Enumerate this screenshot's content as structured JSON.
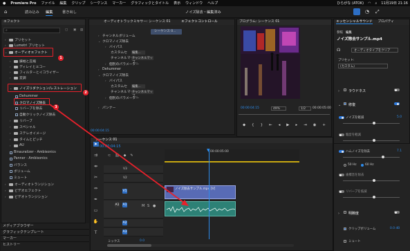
{
  "menubar": {
    "app": "Premiere Pro",
    "items": [
      "ファイル",
      "編集",
      "クリップ",
      "シーケンス",
      "マーカー",
      "グラフィックとタイトル",
      "表示",
      "ウィンドウ",
      "ヘルプ"
    ],
    "ime": "ひらがな (ATOK)",
    "clock": "11月19日 21:16"
  },
  "header": {
    "tabs": [
      "読み込み",
      "編集",
      "書き出し"
    ],
    "title": "ノイズ除去・編集済み"
  },
  "effects": {
    "title": "エフェクト",
    "items": [
      "プリセット",
      "Lumetri プリセット",
      "オーディオエフェクト",
      "振幅と圧縮",
      "ディレイとエコー",
      "フィルターとイコライザー",
      "変調",
      "ノイズリダクション/レストレーション",
      "Dehummer",
      "クロマノイズ除去",
      "リバーブを除去",
      "自動クリックノイズ除去",
      "リバーブ",
      "スペシャル",
      "ステレオイメージ",
      "タイムとピッチ",
      "AU",
      "Binauralizer - Ambisonics",
      "Panner - Ambisonics",
      "バランス",
      "ボリューム",
      "ミュート",
      "オーディオトランジション",
      "ビデオエフェクト",
      "ビデオトランジション"
    ],
    "bottom": [
      "メディアブラウザー",
      "グラフィックテンプレート",
      "マーカー",
      "ヒストリー"
    ],
    "badges": [
      "1",
      "2",
      "3"
    ]
  },
  "audiomixer": {
    "tab1": "オーディオトラックミキサー: シーケンス 01",
    "tab2": "エフェクトコントロール",
    "clip": "シーケンス 0...",
    "rows": [
      "チャンネルボリューム",
      "クロマノイズ除去",
      "バイパス",
      "カスタムセ",
      "編集...",
      "チャンネルマッパ",
      "チャンネルマップ...",
      "個別のパラメーター",
      "Dehummer",
      "クロマノイズ除去",
      "バイパス",
      "カスタムセ",
      "編集...",
      "チャンネルマッパ",
      "チャンネルマップ...",
      "個別のパラメーター",
      "パンナー"
    ],
    "time": "00:00:04:15"
  },
  "program": {
    "title": "プログラム: シーケンス 01",
    "timecode": "00:00:04:15",
    "zoom": "49%",
    "res": "1/2",
    "duration": "00:00:05:00"
  },
  "timeline": {
    "title": "シーケンス 01",
    "timecode": "00:00:04:15",
    "ruler": [
      "00:00:05:00"
    ],
    "clipV": "ノイズ除去サンプル.mp4 [V]",
    "tracks": [
      "V3",
      "V2",
      "V1",
      "A1",
      "A2",
      "A3"
    ],
    "mix": "ミックス",
    "mixval": "0.0"
  },
  "essential": {
    "tab1": "エッセンシャルサウンド",
    "tab2": "プロパティ",
    "sub1": "参照",
    "sub2": "編集",
    "file": "ノイズ除去サンプル.mp4",
    "type": "オーディオタイプをクリア",
    "preset_label": "プリセット:",
    "preset_val": "(カスタム)",
    "sections": [
      "ラウドネス",
      "修復",
      "明瞭度"
    ],
    "items": [
      "ノイズを軽減",
      "騒音を軽減",
      "ハムノイズを除去",
      "歯擦音を除去",
      "リバーブを低減"
    ],
    "values": [
      "5.0",
      "7.1"
    ],
    "hz": [
      "50 Hz",
      "60 Hz"
    ],
    "clear": [
      "クリップボリューム",
      "ミュート"
    ],
    "vol": "0.0 dB"
  }
}
